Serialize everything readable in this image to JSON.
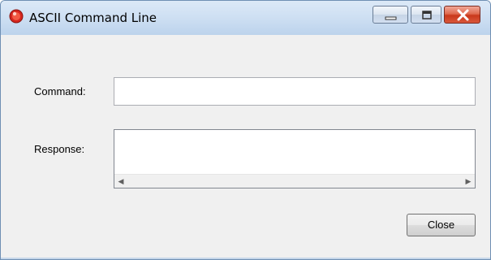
{
  "window": {
    "title": "ASCII Command Line",
    "icon": "app-record-icon",
    "controls": [
      "minimize-icon",
      "maximize-icon",
      "close-icon"
    ]
  },
  "form": {
    "command_label": "Command:",
    "command_value": "",
    "response_label": "Response:",
    "response_value": ""
  },
  "footer": {
    "close_label": "Close"
  },
  "colors": {
    "titlebar": "#cfe0f3",
    "close_button": "#c9381b",
    "app_icon": "#d6261e"
  }
}
